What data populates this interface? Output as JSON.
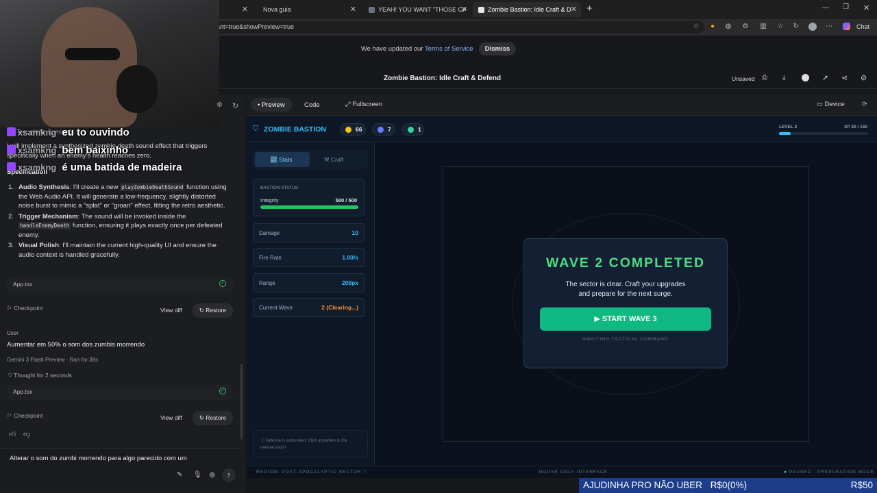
{
  "browser": {
    "tabs": [
      {
        "label": ""
      },
      {
        "label": "Nova guia"
      },
      {
        "label": "YEAH! YOU WANT \"THOSE GAMES\""
      },
      {
        "label": "Zombie Bastion: Idle Craft & D | G"
      }
    ],
    "url": "ant=true&showPreview=true",
    "chat_label": "Chat"
  },
  "notice": {
    "text": "We have updated our ",
    "link": "Terms of Service",
    "dismiss": "Dismiss"
  },
  "topbar": {
    "title": "Zombie Bastion: Idle Craft & Defend",
    "saved_state": "Unsaved"
  },
  "overlay": {
    "lines": [
      {
        "user": "xsamkng",
        "text": "eu to ouvindo"
      },
      {
        "user": "xsamkng",
        "text": "bem baixinho"
      },
      {
        "user": "xsamkng",
        "text": "é uma batida de madeira"
      }
    ],
    "uber_text": "AJUDINHA PRO NÃO UBER",
    "uber_progress": "R$0(0%)",
    "uber_goal": "R$50"
  },
  "chat": {
    "thought_top": "Thought for 2 seconds",
    "intro": "I will implement a synthesized zombie death sound effect that triggers specifically when an enemy's health reaches zero.",
    "spec_heading": "Specification",
    "items": [
      {
        "title": "Audio Synthesis",
        "pre": ": I'll create a new ",
        "code": "playZombieDeathSound",
        "post": " function using the Web Audio API. It will generate a low-frequency, slightly distorted noise burst to mimic a \"splat\" or \"groan\" effect, fitting the retro aesthetic."
      },
      {
        "title": "Trigger Mechanism",
        "pre": ": The sound will be invoked inside the ",
        "code": "handleEnemyDeath",
        "post": " function, ensuring it plays exactly once per defeated enemy."
      },
      {
        "title": "Visual Polish",
        "pre": ": I'll maintain the current high-quality UI and ensure the audio context is handled gracefully.",
        "code": "",
        "post": ""
      }
    ],
    "file1": "App.tsx",
    "checkpoint": "Checkpoint",
    "view_diff": "View diff",
    "restore": "Restore",
    "user_label": "User",
    "user_message": "Aumentar em 50% o som dos zumbis morrendo",
    "model": "Gemini 3 Flash Preview",
    "ran_for": "Ran for 38s",
    "thought2": "Thought for 2 seconds",
    "file2": "App.tsx",
    "input_value": "Alterar o som do zumbi morrendo para algo parecido com um"
  },
  "preview_bar": {
    "preview": "Preview",
    "code": "Code",
    "fullscreen": "Fullscreen",
    "device": "Device"
  },
  "game": {
    "title": "ZOMBIE BASTION",
    "resources": [
      {
        "value": "66",
        "color": "#f5c518"
      },
      {
        "value": "7",
        "color": "#6b7cff"
      },
      {
        "value": "1",
        "color": "#34d399"
      }
    ],
    "level": "LEVEL 2",
    "xp_label": "XP 20 / 150",
    "xp_fraction": 0.133,
    "tabs": {
      "stats": "Stats",
      "craft": "Craft"
    },
    "status_heading": "BASTION STATUS",
    "integrity_label": "Integrity",
    "integrity_value": "500 / 500",
    "integrity_fraction": 1.0,
    "stats": [
      {
        "label": "Damage",
        "value": "10"
      },
      {
        "label": "Fire Rate",
        "value": "1.00/s"
      },
      {
        "label": "Range",
        "value": "200px"
      },
      {
        "label": "Current Wave",
        "value": "2 (Clearing...)"
      }
    ],
    "hint": "Defense is automated. Click anywhere to fire manual shots!",
    "modal_title": "WAVE 2 COMPLETED",
    "modal_text1": "The sector is clear. Craft your upgrades",
    "modal_text2": "and prepare for the next surge.",
    "modal_button": "START WAVE 3",
    "modal_sub": "AWAITING TACTICAL COMMAND",
    "footer_left": "REGION: POST-APOCALYPTIC SECTOR 7",
    "footer_mid": "MOUSE ONLY INTERFACE",
    "footer_right": "PAUSED - PREPARATION MODE"
  }
}
